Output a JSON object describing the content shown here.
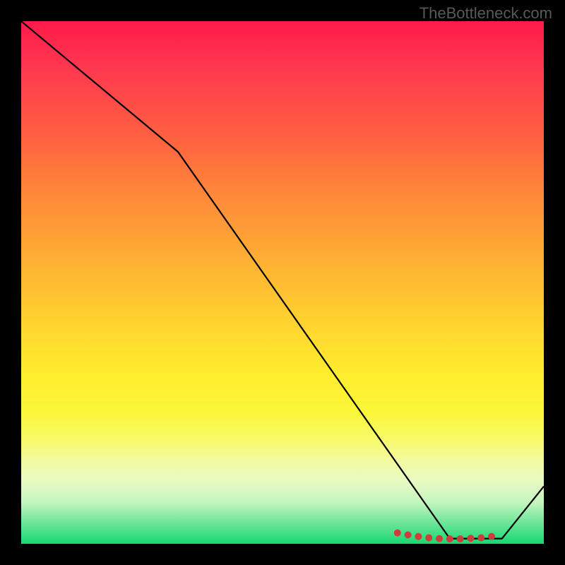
{
  "watermark": "TheBottleneck.com",
  "chart_data": {
    "type": "line",
    "title": "",
    "xlabel": "",
    "ylabel": "",
    "xlim": [
      0,
      100
    ],
    "ylim": [
      0,
      100
    ],
    "series": [
      {
        "name": "curve",
        "x": [
          0,
          30,
          82,
          92,
          100
        ],
        "values": [
          100,
          75,
          1,
          1,
          11
        ]
      }
    ],
    "markers": {
      "name": "highlight",
      "x": [
        72,
        74,
        76,
        78,
        80,
        82,
        84,
        86,
        88,
        90
      ],
      "y": [
        2.1,
        1.7,
        1.4,
        1.15,
        1.0,
        0.95,
        0.95,
        1.05,
        1.15,
        1.4
      ],
      "color": "#d03b3b",
      "size": 5
    },
    "gradient_stops": [
      {
        "pos": 0,
        "color": "#ff1a4a"
      },
      {
        "pos": 22,
        "color": "#ff6040"
      },
      {
        "pos": 46,
        "color": "#ffb033"
      },
      {
        "pos": 68,
        "color": "#ffee2e"
      },
      {
        "pos": 88,
        "color": "#e8fbc2"
      },
      {
        "pos": 100,
        "color": "#17d873"
      }
    ]
  }
}
